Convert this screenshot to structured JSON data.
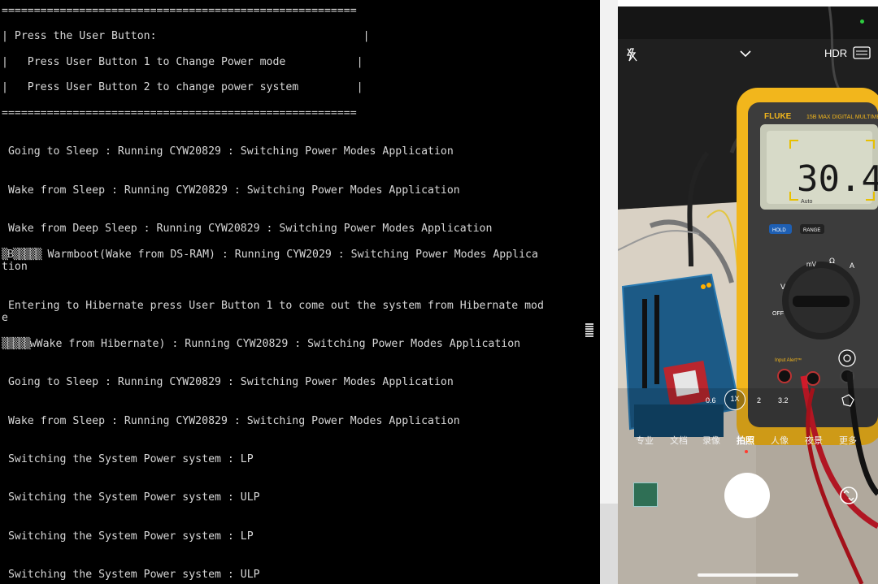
{
  "terminal": {
    "lines": {
      "sep1": "=======================================================",
      "menu_title": "| Press the User Button:                                |",
      "menu_item1": "|   Press User Button 1 to Change Power mode           |",
      "menu_item2": "|   Press User Button 2 to change power system         |",
      "sep2": "=======================================================",
      "l1": " Going to Sleep : Running CYW20829 : Switching Power Modes Application",
      "l2": " Wake from Sleep : Running CYW20829 : Switching Power Modes Application",
      "l3": " Wake from Deep Sleep : Running CYW20829 : Switching Power Modes Application",
      "l4_prefix": "▒B▒▒▒▒▒",
      "l4_text": " Warmboot(Wake from DS-RAM) : Running CYW2029 : Switching Power Modes Applica",
      "l4_cont": "tion",
      "l5": " Entering to Hibernate press User Button 1 to come out the system from Hibernate mod",
      "l5_cont": "e",
      "l6_prefix": "▒▒▒▒▒",
      "l6_text": "wWake from Hibernate) : Running CYW20829 : Switching Power Modes Application",
      "l7": " Going to Sleep : Running CYW20829 : Switching Power Modes Application",
      "l8": " Wake from Sleep : Running CYW20829 : Switching Power Modes Application",
      "l9": " Switching the System Power system : LP",
      "l10": " Switching the System Power system : ULP",
      "l11": " Switching the System Power system : LP",
      "l12": " Switching the System Power system : ULP"
    }
  },
  "camera": {
    "hdr_label": "HDR",
    "meter_brand": "FLUKE",
    "meter_model": "15B MAX",
    "meter_model_sub": "DIGITAL MULTIMETER",
    "meter_reading": "30.4",
    "meter_hold": "HOLD",
    "meter_range": "RANGE",
    "meter_auto": "Auto",
    "meter_off": "OFF",
    "meter_input_alert": "Input Alert™",
    "meter_unit_mv": "mV",
    "meter_unit_ohm": "Ω",
    "meter_unit_a": "A",
    "meter_unit_v": "V",
    "zoom_levels": [
      "0.6",
      "1X",
      "2",
      "3.2"
    ],
    "modes": [
      "专业",
      "文档",
      "录像",
      "拍照",
      "人像",
      "夜景",
      "更多"
    ],
    "selected_mode": "拍照",
    "colors": {
      "meter_yellow": "#f2b61c",
      "meter_face": "#3c3c3c",
      "board_blue": "#1c5a86",
      "shutter": "#ffffff",
      "wire_red": "#d11a2a"
    }
  }
}
